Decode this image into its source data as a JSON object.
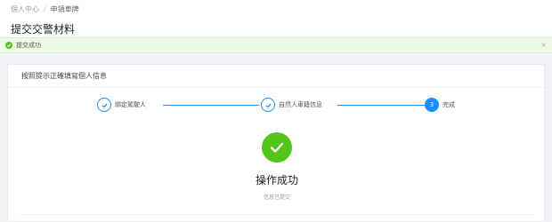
{
  "breadcrumb": {
    "items": [
      "個人中心",
      "申領車牌"
    ],
    "separator": "/"
  },
  "header": {
    "title": "提交交警材料"
  },
  "alert": {
    "text": "提交成功",
    "close_glyph": "×",
    "color": "#52c41a"
  },
  "card": {
    "header": "按照提示正確填寫個人信息"
  },
  "steps": [
    {
      "label": "綁定駕駛人",
      "status": "done"
    },
    {
      "label": "自然人車籍信息",
      "status": "done"
    },
    {
      "label": "完成",
      "number": "3",
      "status": "active"
    }
  ],
  "result": {
    "title": "操作成功",
    "description": "信息已提交",
    "icon": "check-circle-icon",
    "color": "#52c41a"
  },
  "colors": {
    "primary": "#1890ff",
    "success": "#52c41a",
    "background": "#f0f2f5"
  }
}
